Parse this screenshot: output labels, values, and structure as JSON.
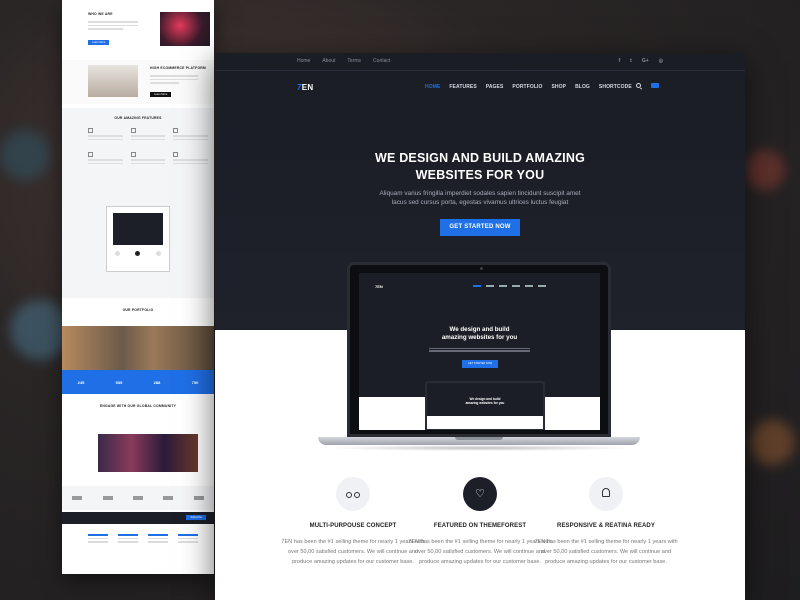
{
  "back_page": {
    "who_we_are": "WHO WE ARE",
    "ecommerce": "HIGH ECOMMERCE PLATFORM",
    "learn_more": "Learn More",
    "features_heading": "OUR AMAZING FEATURES",
    "portfolio_heading": "OUR PORTFOLIO",
    "stats": [
      "245",
      "535",
      "288",
      "750"
    ],
    "community": "ENGAGE WITH OUR GLOBAL COMMUNITY",
    "subscribe_btn": "Subscribe"
  },
  "topbar": {
    "links": [
      "Home",
      "About",
      "Terms",
      "Contact"
    ],
    "social": [
      "f",
      "t",
      "G+",
      "◎"
    ]
  },
  "logo": {
    "mark": "7",
    "text": "EN"
  },
  "nav": {
    "items": [
      "HOME",
      "FEATURES",
      "PAGES",
      "PORTFOLIO",
      "SHOP",
      "BLOG",
      "SHORTCODE"
    ],
    "active_index": 0
  },
  "hero": {
    "title_line1": "WE DESIGN AND BUILD AMAZING",
    "title_line2": "WEBSITES FOR YOU",
    "subtitle_line1": "Aliquam varius fringilla imperdiet sodales sapien tincidunt suscipit amet",
    "subtitle_line2": "lacus sed cursus porta, egestas vivamus ultrices luctus feugiat",
    "cta": "GET STARTED NOW"
  },
  "laptop": {
    "logo": "7EN",
    "title_line1": "We design and build",
    "title_line2": "amazing websites for you",
    "cta": "GET STARTED NOW",
    "mini_title_line1": "We design and build",
    "mini_title_line2": "amazing websites for you"
  },
  "features": [
    {
      "icon": "bicycle-icon",
      "title": "MULTI-PURPOUSE CONCEPT",
      "text": "7EN has been the #1 selling theme for nearly 1 years with over 50,00 satisfied customers. We will continue and produce amazing updates for our customer base."
    },
    {
      "icon": "heart-icon",
      "title": "FEATURED ON THEMEFOREST",
      "text": "7EN has been the #1 selling theme for nearly 1 years with over 50,00 satisfied customers. We will continue and produce amazing updates for our customer base."
    },
    {
      "icon": "bell-icon",
      "title": "RESPONSIVE & REATINA READY",
      "text": "7EN has been the #1 selling theme for nearly 1 years with over 50,00 satisfied customers. We will continue and produce amazing updates for our customer base."
    }
  ],
  "colors": {
    "accent": "#1f6fe6",
    "hero_bg": "#1d1f28"
  }
}
